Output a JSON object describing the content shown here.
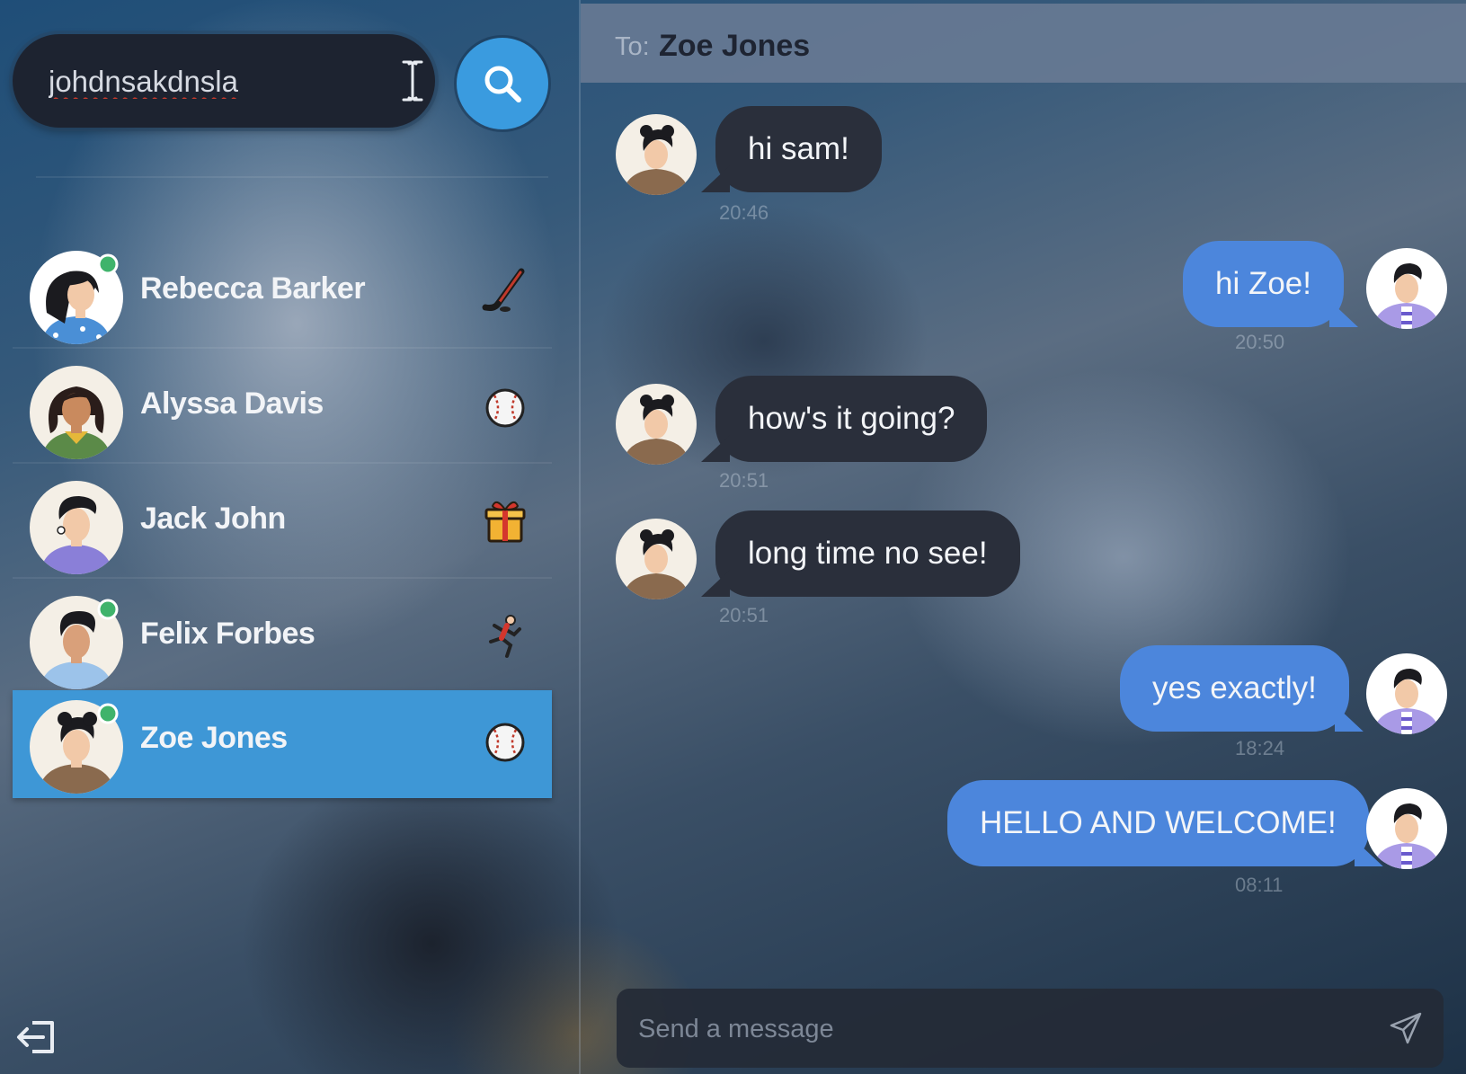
{
  "search": {
    "value": "johdnsakdnsla",
    "icon": "search-icon"
  },
  "contacts": [
    {
      "name": "Rebecca Barker",
      "online": true,
      "status_icon": "hockey-stick-icon",
      "active": false
    },
    {
      "name": "Alyssa Davis",
      "online": false,
      "status_icon": "baseball-icon",
      "active": false
    },
    {
      "name": "Jack John",
      "online": false,
      "status_icon": "gift-icon",
      "active": false
    },
    {
      "name": "Felix Forbes",
      "online": true,
      "status_icon": "person-running-icon",
      "active": false
    },
    {
      "name": "Zoe Jones",
      "online": true,
      "status_icon": "baseball-icon",
      "active": true
    }
  ],
  "chat": {
    "to_label": "To:",
    "to_name": "Zoe Jones",
    "messages": [
      {
        "text": "hi sam!",
        "time": "20:46",
        "direction": "in"
      },
      {
        "text": "hi Zoe!",
        "time": "20:50",
        "direction": "out"
      },
      {
        "text": "how's it going?",
        "time": "20:51",
        "direction": "in"
      },
      {
        "text": "long time no see!",
        "time": "20:51",
        "direction": "in"
      },
      {
        "text": "yes exactly!",
        "time": "18:24",
        "direction": "out"
      },
      {
        "text": "HELLO AND WELCOME!",
        "time": "08:11",
        "direction": "out"
      }
    ],
    "composer": {
      "placeholder": "Send a message",
      "send_icon": "send-icon"
    }
  },
  "colors": {
    "accent": "#3a9bdf",
    "active_contact": "#3e97d6",
    "outgoing_bubble": "#4c86dc",
    "incoming_bubble": "#2a2f3b",
    "online_dot": "#3fb36b"
  }
}
